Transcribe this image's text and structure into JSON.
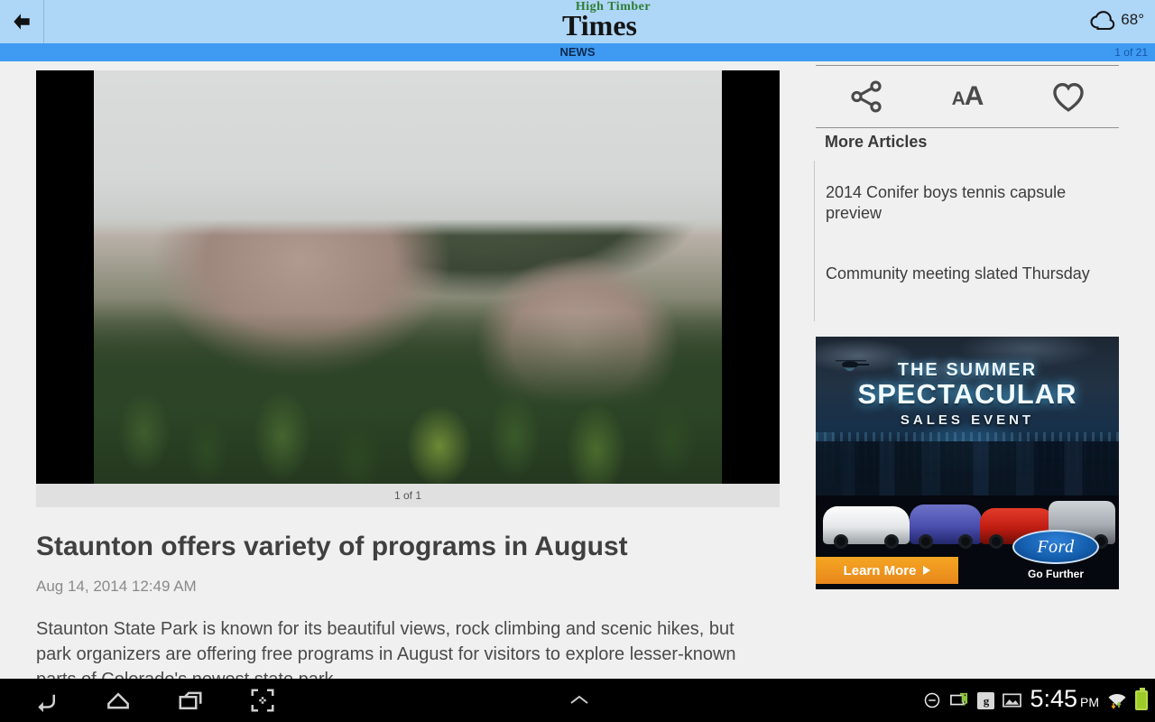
{
  "appbar": {
    "back_icon": "back-arrow-icon",
    "logo_top": "High Timber",
    "logo_main": "Times",
    "weather_icon": "cloud-icon",
    "temperature": "68°"
  },
  "sectionbar": {
    "section": "NEWS",
    "page_count": "1 of 21"
  },
  "article": {
    "photo_caption": "1 of 1",
    "headline": "Staunton offers variety of programs in August",
    "timestamp": "Aug 14, 2014 12:49 AM",
    "body": "Staunton State Park is known for its beautiful views, rock climbing and scenic hikes, but park organizers are offering free programs in August for visitors to explore lesser-known parts of Colorado's newest state park."
  },
  "sidebar": {
    "tools": [
      {
        "name": "share-icon",
        "label": "Share"
      },
      {
        "name": "text-size-icon",
        "label": "AA"
      },
      {
        "name": "favorite-heart-icon",
        "label": "Favorite"
      }
    ],
    "more_articles_title": "More Articles",
    "articles": [
      "2014 Conifer boys tennis capsule preview",
      "Community meeting slated Thursday"
    ]
  },
  "ad": {
    "title_line1": "THE SUMMER",
    "title_line2": "SPECTACULAR",
    "subtitle": "SALES EVENT",
    "cta": "Learn More",
    "brand": "Ford",
    "tagline": "Go Further"
  },
  "navbar": {
    "back_icon": "nav-back-icon",
    "home_icon": "nav-home-icon",
    "recents_icon": "nav-recents-icon",
    "screenshot_icon": "nav-screenshot-icon",
    "expand_icon": "chevron-up-icon",
    "status": {
      "dnd_icon": "do-not-disturb-icon",
      "usb_icon": "usb-transfer-icon",
      "gplus_icon": "google-plus-icon",
      "gplus_label": "g",
      "image_icon": "image-icon",
      "time": "5:45",
      "ampm": "PM",
      "wifi_icon": "wifi-icon",
      "battery_icon": "battery-icon"
    }
  },
  "colors": {
    "appbar_bg": "#aed6f7",
    "section_bg": "#3f9bf2",
    "page_bg": "#f0f0f0",
    "accent_green": "#2f7d32",
    "cta_orange": "#e8871b"
  }
}
